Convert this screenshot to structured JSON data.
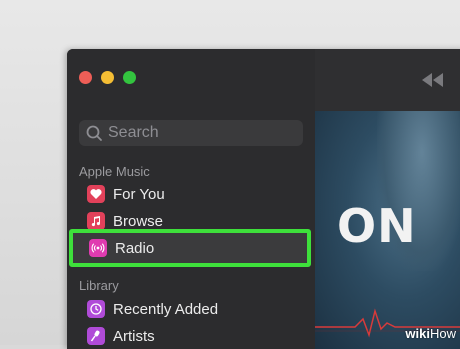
{
  "window": {
    "search": {
      "placeholder": "Search"
    }
  },
  "sidebar": {
    "sections": [
      {
        "title": "Apple Music",
        "items": [
          {
            "label": "For You",
            "icon": "heart-icon",
            "color": "#e2415a"
          },
          {
            "label": "Browse",
            "icon": "music-note-icon",
            "color": "#e2415a"
          },
          {
            "label": "Radio",
            "icon": "radio-waves-icon",
            "color": "#e03bb0",
            "selected": true
          }
        ]
      },
      {
        "title": "Library",
        "items": [
          {
            "label": "Recently Added",
            "icon": "clock-icon",
            "color": "#b04bd8"
          },
          {
            "label": "Artists",
            "icon": "microphone-icon",
            "color": "#b04bd8"
          }
        ]
      }
    ]
  },
  "toolbar": {
    "rewind_icon": "rewind-icon"
  },
  "artwork": {
    "text": "ON"
  },
  "watermark": {
    "wiki": "wiki",
    "how": "How"
  },
  "colors": {
    "highlight": "#3ee03b",
    "sidebar_bg": "#2c2c2e"
  }
}
